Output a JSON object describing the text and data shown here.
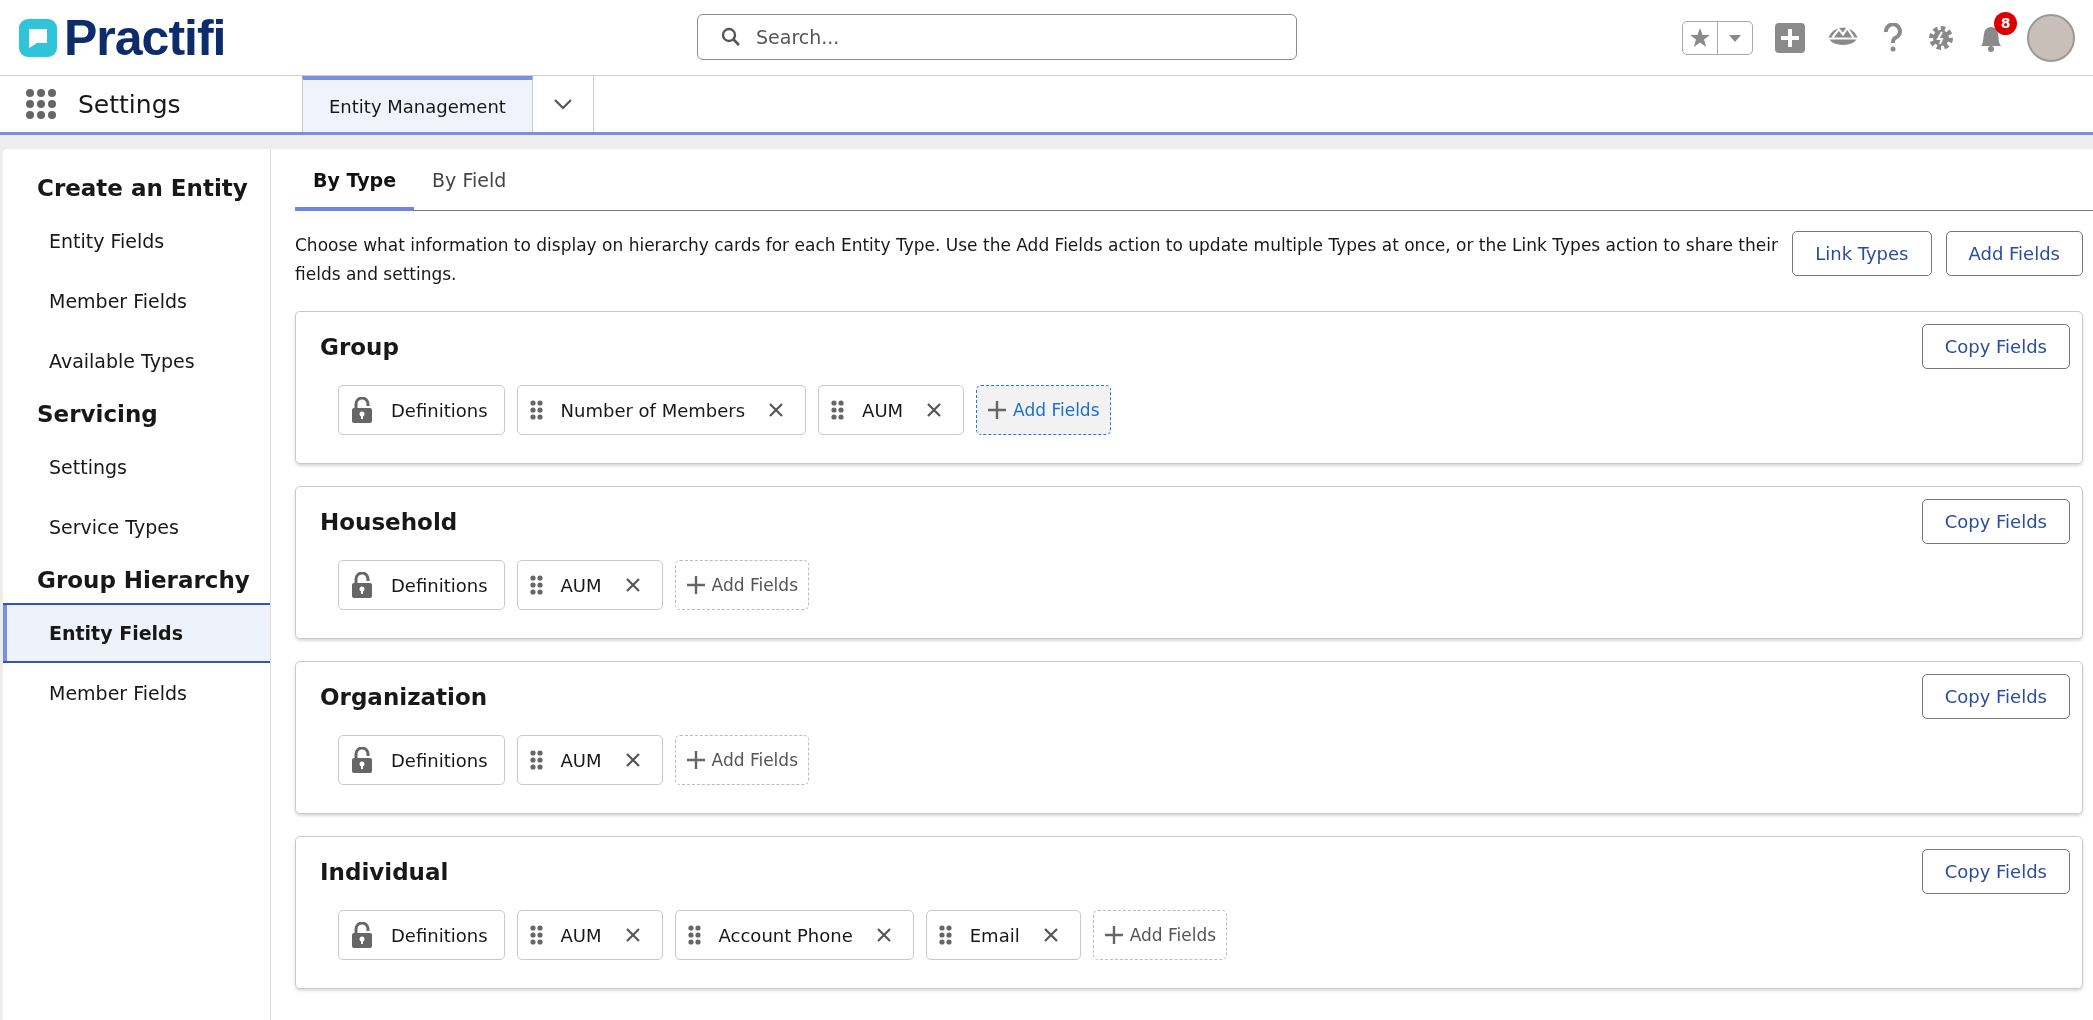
{
  "header": {
    "logo": "Practifi",
    "search": {
      "placeholder": "Search..."
    },
    "notifications": {
      "count": "8"
    }
  },
  "nav": {
    "app_title": "Settings",
    "tabs": [
      {
        "label": "Entity Management",
        "selected": true
      }
    ]
  },
  "sidebar": {
    "sections": [
      {
        "title": "Create an Entity",
        "items": [
          {
            "label": "Entity Fields",
            "selected": false
          },
          {
            "label": "Member Fields",
            "selected": false
          },
          {
            "label": "Available Types",
            "selected": false
          }
        ]
      },
      {
        "title": "Servicing",
        "items": [
          {
            "label": "Settings",
            "selected": false
          },
          {
            "label": "Service Types",
            "selected": false
          }
        ]
      },
      {
        "title": "Group Hierarchy",
        "items": [
          {
            "label": "Entity Fields",
            "selected": true
          },
          {
            "label": "Member Fields",
            "selected": false
          }
        ]
      }
    ]
  },
  "main": {
    "tabs": [
      {
        "label": "By Type",
        "selected": true
      },
      {
        "label": "By Field",
        "selected": false
      }
    ],
    "description": "Choose what information to display on hierarchy cards for each Entity Type. Use the Add Fields action to update multiple Types at once, or the Link Types action to share their fields and settings.",
    "buttons": [
      "Link Types",
      "Add Fields"
    ],
    "types": [
      {
        "name": "Group",
        "copy_button": "Copy Fields",
        "fields": [
          {
            "label": "Definitions",
            "kind": "locked"
          },
          {
            "label": "Number of Members",
            "kind": "removable"
          },
          {
            "label": "AUM",
            "kind": "removable"
          }
        ],
        "add_button": {
          "label": "Add Fields",
          "focused": true
        }
      },
      {
        "name": "Household",
        "copy_button": "Copy Fields",
        "fields": [
          {
            "label": "Definitions",
            "kind": "locked"
          },
          {
            "label": "AUM",
            "kind": "removable"
          }
        ],
        "add_button": {
          "label": "Add Fields",
          "focused": false
        }
      },
      {
        "name": "Organization",
        "copy_button": "Copy Fields",
        "fields": [
          {
            "label": "Definitions",
            "kind": "locked"
          },
          {
            "label": "AUM",
            "kind": "removable"
          }
        ],
        "add_button": {
          "label": "Add Fields",
          "focused": false
        }
      },
      {
        "name": "Individual",
        "copy_button": "Copy Fields",
        "fields": [
          {
            "label": "Definitions",
            "kind": "locked"
          },
          {
            "label": "AUM",
            "kind": "removable"
          },
          {
            "label": "Account Phone",
            "kind": "removable"
          },
          {
            "label": "Email",
            "kind": "removable"
          }
        ],
        "add_button": {
          "label": "Add Fields",
          "focused": false
        }
      }
    ]
  }
}
